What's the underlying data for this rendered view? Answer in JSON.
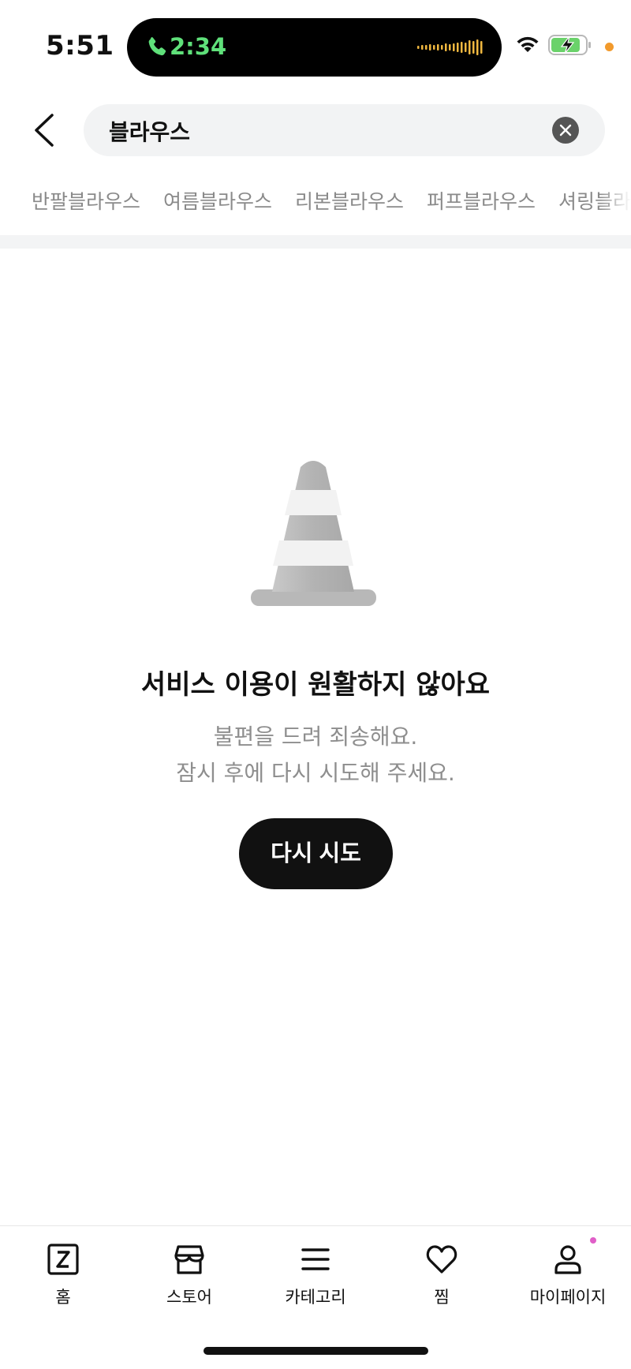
{
  "status_bar": {
    "time": "5:51",
    "call_timer": "2:34",
    "call_color": "#5fe07a",
    "battery_color": "#6ad26a",
    "indicator_dot_color": "#f29a2c"
  },
  "search": {
    "query": "블라우스",
    "back_icon": "chevron-left-icon",
    "clear_icon": "close-circle-icon"
  },
  "keywords": [
    "반팔블라우스",
    "여름블라우스",
    "리본블라우스",
    "퍼프블라우스",
    "셔링블라우스"
  ],
  "error": {
    "icon": "traffic-cone-icon",
    "title": "서비스 이용이 원활하지 않아요",
    "description_line1": "불편을 드려 죄송해요.",
    "description_line2": "잠시 후에 다시 시도해 주세요.",
    "retry_label": "다시 시도"
  },
  "bottom_nav": {
    "home": "홈",
    "store": "스토어",
    "category": "카테고리",
    "wishlist": "찜",
    "mypage": "마이페이지",
    "notification_dot_color": "#e05fc8"
  }
}
